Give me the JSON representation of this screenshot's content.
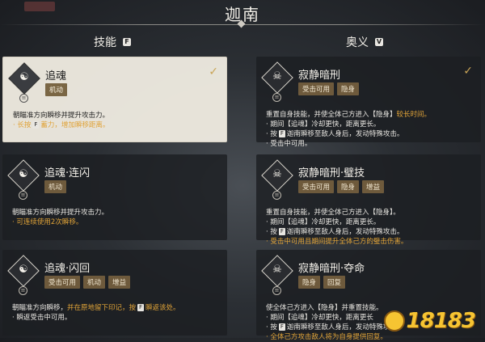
{
  "header": {
    "title": "迦南",
    "tab_indicator": ""
  },
  "columns": {
    "left": {
      "label": "技能",
      "key": "F"
    },
    "right": {
      "label": "奥义",
      "key": "V"
    }
  },
  "skills": [
    {
      "name": "追魂",
      "tags": [
        "机动"
      ],
      "selected": true,
      "check": "✓",
      "icon": "swirl-icon",
      "desc": [
        {
          "parts": [
            {
              "t": "朝瞄准方向瞬移并提升攻击力。"
            }
          ]
        },
        {
          "parts": [
            {
              "t": "· 长按",
              "hl": true
            },
            {
              "k": "F"
            },
            {
              "t": "蓄力，增加瞬移距离。",
              "hl": true
            }
          ]
        }
      ]
    },
    {
      "name": "追魂·连闪",
      "tags": [
        "机动"
      ],
      "selected": false,
      "icon": "swirl-icon",
      "desc": [
        {
          "parts": [
            {
              "t": "朝瞄准方向瞬移并提升攻击力。"
            }
          ]
        },
        {
          "parts": [
            {
              "t": "· 可连续使用2次瞬移。",
              "hl": true
            }
          ]
        }
      ]
    },
    {
      "name": "追魂·闪回",
      "tags": [
        "受击可用",
        "机动",
        "增益"
      ],
      "selected": false,
      "icon": "swirl-icon",
      "desc": [
        {
          "parts": [
            {
              "t": "朝瞄准方向瞬移，"
            },
            {
              "t": "并在原地留下印记，按",
              "hl": true
            },
            {
              "k": "F"
            },
            {
              "t": "瞬返该处。",
              "hl": true
            }
          ]
        },
        {
          "parts": [
            {
              "t": "· 瞬返受击中可用。"
            }
          ]
        }
      ]
    }
  ],
  "ultimates": [
    {
      "name": "寂静暗刑",
      "tags": [
        "受击可用",
        "隐身"
      ],
      "selected": false,
      "check": "✓",
      "icon": "mask-icon",
      "desc": [
        {
          "parts": [
            {
              "t": "重置自身技能，并使全体己方进入【隐身】"
            },
            {
              "t": "较长时间。",
              "hl": true
            }
          ]
        },
        {
          "parts": [
            {
              "t": "· 期间【追魂】冷却更快，距离更长。"
            }
          ]
        },
        {
          "parts": [
            {
              "t": "· 按"
            },
            {
              "k": "F"
            },
            {
              "t": "迦南瞬移至敌人身后，发动特殊攻击。"
            }
          ]
        },
        {
          "parts": [
            {
              "t": "· 受击中可用。"
            }
          ]
        }
      ]
    },
    {
      "name": "寂静暗刑·璧技",
      "tags": [
        "受击可用",
        "隐身",
        "增益"
      ],
      "selected": false,
      "icon": "mask-icon",
      "desc": [
        {
          "parts": [
            {
              "t": "重置自身技能，并使全体己方进入【隐身】。"
            }
          ]
        },
        {
          "parts": [
            {
              "t": "· 期间【追魂】冷却更快，距离更长。"
            }
          ]
        },
        {
          "parts": [
            {
              "t": "· 按"
            },
            {
              "k": "F"
            },
            {
              "t": "迦南瞬移至敌人身后，发动特殊攻击。"
            }
          ]
        },
        {
          "parts": [
            {
              "t": "· 受击中可用且期间提升全体己方的璧击伤害。",
              "hl": true
            }
          ]
        }
      ]
    },
    {
      "name": "寂静暗刑·夺命",
      "tags": [
        "隐身",
        "回复"
      ],
      "selected": false,
      "icon": "mask-icon",
      "desc": [
        {
          "parts": [
            {
              "t": "使全体己方进入【隐身】并重置技能。"
            }
          ]
        },
        {
          "parts": [
            {
              "t": "· 期间【追魂】冷却更快，距离更长"
            }
          ]
        },
        {
          "parts": [
            {
              "t": "· 按"
            },
            {
              "k": "F"
            },
            {
              "t": "迦南瞬移至敌人身后，发动特殊攻击。"
            }
          ]
        },
        {
          "parts": [
            {
              "t": "· 全体己方攻击敌人将为自身提供回复。",
              "hl": true
            }
          ]
        }
      ]
    }
  ],
  "watermark": {
    "text": "18183"
  },
  "colors": {
    "highlight": "#e0a338",
    "tag_bg": "#6e5a3c",
    "selected_bg": "#eeeae0"
  }
}
